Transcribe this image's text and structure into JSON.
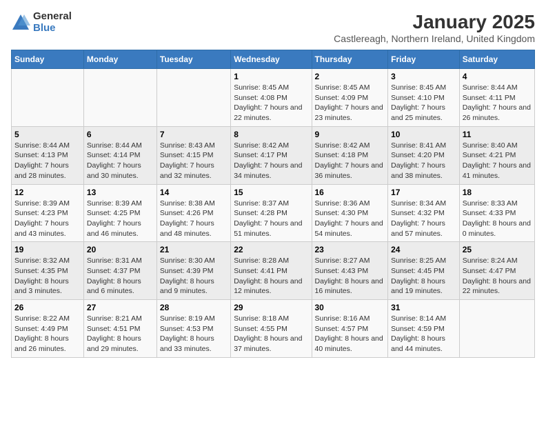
{
  "logo": {
    "general": "General",
    "blue": "Blue"
  },
  "title": "January 2025",
  "subtitle": "Castlereagh, Northern Ireland, United Kingdom",
  "days_of_week": [
    "Sunday",
    "Monday",
    "Tuesday",
    "Wednesday",
    "Thursday",
    "Friday",
    "Saturday"
  ],
  "weeks": [
    [
      {
        "day": "",
        "sunrise": "",
        "sunset": "",
        "daylight": ""
      },
      {
        "day": "",
        "sunrise": "",
        "sunset": "",
        "daylight": ""
      },
      {
        "day": "",
        "sunrise": "",
        "sunset": "",
        "daylight": ""
      },
      {
        "day": "1",
        "sunrise": "Sunrise: 8:45 AM",
        "sunset": "Sunset: 4:08 PM",
        "daylight": "Daylight: 7 hours and 22 minutes."
      },
      {
        "day": "2",
        "sunrise": "Sunrise: 8:45 AM",
        "sunset": "Sunset: 4:09 PM",
        "daylight": "Daylight: 7 hours and 23 minutes."
      },
      {
        "day": "3",
        "sunrise": "Sunrise: 8:45 AM",
        "sunset": "Sunset: 4:10 PM",
        "daylight": "Daylight: 7 hours and 25 minutes."
      },
      {
        "day": "4",
        "sunrise": "Sunrise: 8:44 AM",
        "sunset": "Sunset: 4:11 PM",
        "daylight": "Daylight: 7 hours and 26 minutes."
      }
    ],
    [
      {
        "day": "5",
        "sunrise": "Sunrise: 8:44 AM",
        "sunset": "Sunset: 4:13 PM",
        "daylight": "Daylight: 7 hours and 28 minutes."
      },
      {
        "day": "6",
        "sunrise": "Sunrise: 8:44 AM",
        "sunset": "Sunset: 4:14 PM",
        "daylight": "Daylight: 7 hours and 30 minutes."
      },
      {
        "day": "7",
        "sunrise": "Sunrise: 8:43 AM",
        "sunset": "Sunset: 4:15 PM",
        "daylight": "Daylight: 7 hours and 32 minutes."
      },
      {
        "day": "8",
        "sunrise": "Sunrise: 8:42 AM",
        "sunset": "Sunset: 4:17 PM",
        "daylight": "Daylight: 7 hours and 34 minutes."
      },
      {
        "day": "9",
        "sunrise": "Sunrise: 8:42 AM",
        "sunset": "Sunset: 4:18 PM",
        "daylight": "Daylight: 7 hours and 36 minutes."
      },
      {
        "day": "10",
        "sunrise": "Sunrise: 8:41 AM",
        "sunset": "Sunset: 4:20 PM",
        "daylight": "Daylight: 7 hours and 38 minutes."
      },
      {
        "day": "11",
        "sunrise": "Sunrise: 8:40 AM",
        "sunset": "Sunset: 4:21 PM",
        "daylight": "Daylight: 7 hours and 41 minutes."
      }
    ],
    [
      {
        "day": "12",
        "sunrise": "Sunrise: 8:39 AM",
        "sunset": "Sunset: 4:23 PM",
        "daylight": "Daylight: 7 hours and 43 minutes."
      },
      {
        "day": "13",
        "sunrise": "Sunrise: 8:39 AM",
        "sunset": "Sunset: 4:25 PM",
        "daylight": "Daylight: 7 hours and 46 minutes."
      },
      {
        "day": "14",
        "sunrise": "Sunrise: 8:38 AM",
        "sunset": "Sunset: 4:26 PM",
        "daylight": "Daylight: 7 hours and 48 minutes."
      },
      {
        "day": "15",
        "sunrise": "Sunrise: 8:37 AM",
        "sunset": "Sunset: 4:28 PM",
        "daylight": "Daylight: 7 hours and 51 minutes."
      },
      {
        "day": "16",
        "sunrise": "Sunrise: 8:36 AM",
        "sunset": "Sunset: 4:30 PM",
        "daylight": "Daylight: 7 hours and 54 minutes."
      },
      {
        "day": "17",
        "sunrise": "Sunrise: 8:34 AM",
        "sunset": "Sunset: 4:32 PM",
        "daylight": "Daylight: 7 hours and 57 minutes."
      },
      {
        "day": "18",
        "sunrise": "Sunrise: 8:33 AM",
        "sunset": "Sunset: 4:33 PM",
        "daylight": "Daylight: 8 hours and 0 minutes."
      }
    ],
    [
      {
        "day": "19",
        "sunrise": "Sunrise: 8:32 AM",
        "sunset": "Sunset: 4:35 PM",
        "daylight": "Daylight: 8 hours and 3 minutes."
      },
      {
        "day": "20",
        "sunrise": "Sunrise: 8:31 AM",
        "sunset": "Sunset: 4:37 PM",
        "daylight": "Daylight: 8 hours and 6 minutes."
      },
      {
        "day": "21",
        "sunrise": "Sunrise: 8:30 AM",
        "sunset": "Sunset: 4:39 PM",
        "daylight": "Daylight: 8 hours and 9 minutes."
      },
      {
        "day": "22",
        "sunrise": "Sunrise: 8:28 AM",
        "sunset": "Sunset: 4:41 PM",
        "daylight": "Daylight: 8 hours and 12 minutes."
      },
      {
        "day": "23",
        "sunrise": "Sunrise: 8:27 AM",
        "sunset": "Sunset: 4:43 PM",
        "daylight": "Daylight: 8 hours and 16 minutes."
      },
      {
        "day": "24",
        "sunrise": "Sunrise: 8:25 AM",
        "sunset": "Sunset: 4:45 PM",
        "daylight": "Daylight: 8 hours and 19 minutes."
      },
      {
        "day": "25",
        "sunrise": "Sunrise: 8:24 AM",
        "sunset": "Sunset: 4:47 PM",
        "daylight": "Daylight: 8 hours and 22 minutes."
      }
    ],
    [
      {
        "day": "26",
        "sunrise": "Sunrise: 8:22 AM",
        "sunset": "Sunset: 4:49 PM",
        "daylight": "Daylight: 8 hours and 26 minutes."
      },
      {
        "day": "27",
        "sunrise": "Sunrise: 8:21 AM",
        "sunset": "Sunset: 4:51 PM",
        "daylight": "Daylight: 8 hours and 29 minutes."
      },
      {
        "day": "28",
        "sunrise": "Sunrise: 8:19 AM",
        "sunset": "Sunset: 4:53 PM",
        "daylight": "Daylight: 8 hours and 33 minutes."
      },
      {
        "day": "29",
        "sunrise": "Sunrise: 8:18 AM",
        "sunset": "Sunset: 4:55 PM",
        "daylight": "Daylight: 8 hours and 37 minutes."
      },
      {
        "day": "30",
        "sunrise": "Sunrise: 8:16 AM",
        "sunset": "Sunset: 4:57 PM",
        "daylight": "Daylight: 8 hours and 40 minutes."
      },
      {
        "day": "31",
        "sunrise": "Sunrise: 8:14 AM",
        "sunset": "Sunset: 4:59 PM",
        "daylight": "Daylight: 8 hours and 44 minutes."
      },
      {
        "day": "",
        "sunrise": "",
        "sunset": "",
        "daylight": ""
      }
    ]
  ]
}
